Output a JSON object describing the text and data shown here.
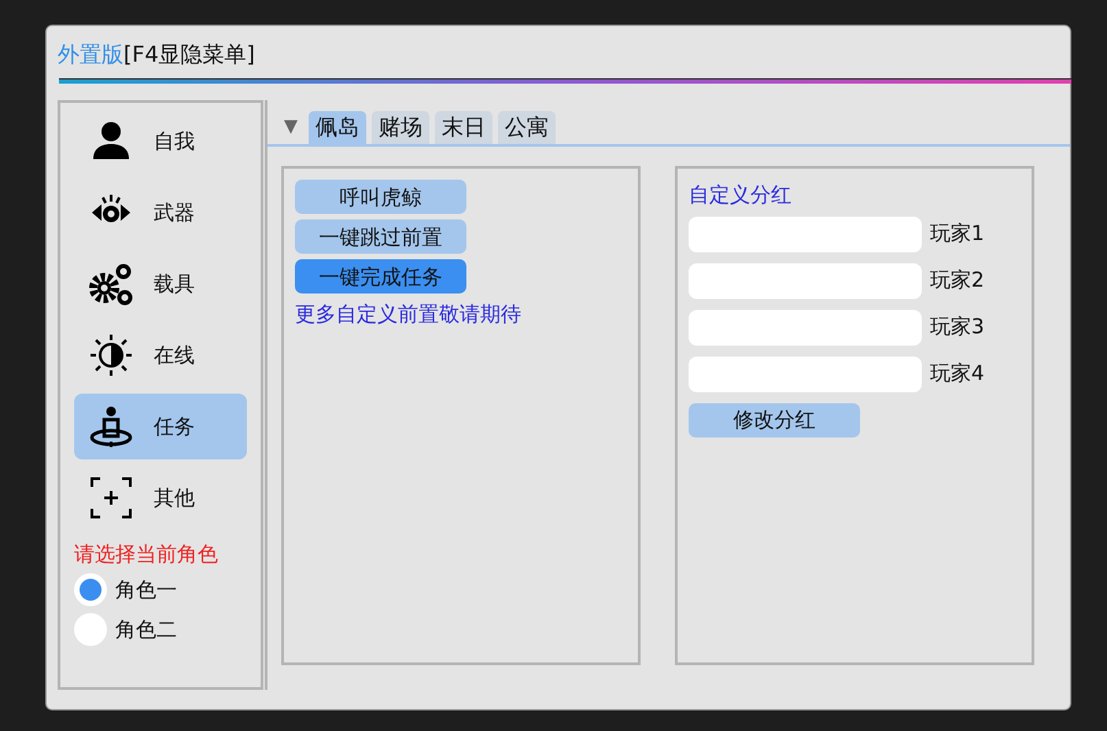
{
  "window": {
    "title_prefix": "外置版",
    "title": "[F4显隐菜单]"
  },
  "sidebar": {
    "items": [
      {
        "label": "自我",
        "kind": "person",
        "selected": false
      },
      {
        "label": "武器",
        "kind": "eye",
        "selected": false
      },
      {
        "label": "载具",
        "kind": "gears",
        "selected": false
      },
      {
        "label": "在线",
        "kind": "sun",
        "selected": false
      },
      {
        "label": "任务",
        "kind": "meditate",
        "selected": true
      },
      {
        "label": "其他",
        "kind": "plus",
        "selected": false
      }
    ],
    "role_prompt": "请选择当前角色",
    "roles": [
      {
        "label": "角色一",
        "selected": true
      },
      {
        "label": "角色二",
        "selected": false
      }
    ]
  },
  "tabs_toggle": "▼",
  "tabs": [
    {
      "label": "佩岛",
      "selected": true
    },
    {
      "label": "赌场",
      "selected": false
    },
    {
      "label": "末日",
      "selected": false
    },
    {
      "label": "公寓",
      "selected": false
    }
  ],
  "left_group": {
    "buttons": [
      {
        "label": "呼叫虎鲸",
        "active": false
      },
      {
        "label": "一键跳过前置",
        "active": false
      },
      {
        "label": "一键完成任务",
        "active": true
      }
    ],
    "note": "更多自定义前置敬请期待"
  },
  "right_group": {
    "heading": "自定义分红",
    "fields": [
      {
        "label": "玩家1"
      },
      {
        "label": "玩家2"
      },
      {
        "label": "玩家3"
      },
      {
        "label": "玩家4"
      }
    ],
    "button": "修改分红"
  }
}
